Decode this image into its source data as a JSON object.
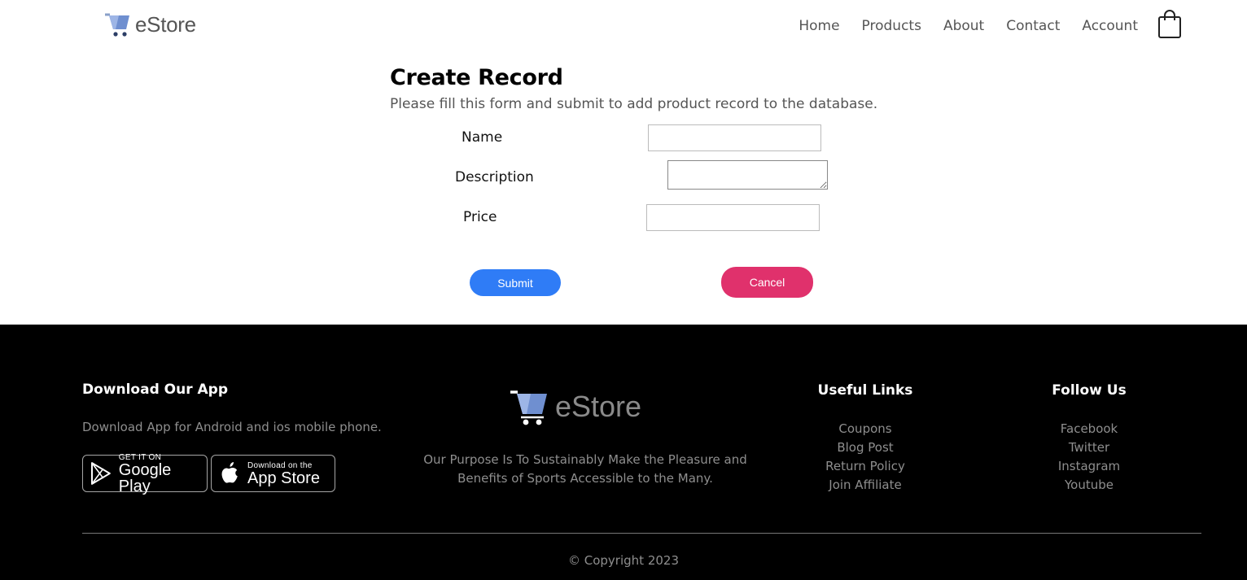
{
  "header": {
    "logo_text": "eStore",
    "nav": [
      {
        "label": "Home"
      },
      {
        "label": "Products"
      },
      {
        "label": "About"
      },
      {
        "label": "Contact"
      },
      {
        "label": "Account"
      }
    ],
    "cart_icon": "shopping-bag-icon"
  },
  "form": {
    "title": "Create Record",
    "subtitle": "Please fill this form and submit to add product record to the database.",
    "name_label": "Name",
    "name_value": "",
    "description_label": "Description",
    "description_value": "",
    "price_label": "Price",
    "price_value": "",
    "submit_label": "Submit",
    "cancel_label": "Cancel",
    "submit_color": "#2f7cf6",
    "cancel_color": "#e0316c"
  },
  "footer": {
    "app_heading": "Download Our App",
    "app_text": "Download App for Android and ios mobile phone.",
    "google_play": {
      "small": "GET IT ON",
      "big": "Google Play",
      "icon": "google-play-icon"
    },
    "app_store": {
      "small": "Download on the",
      "big": "App Store",
      "icon": "apple-icon"
    },
    "logo_text": "eStore",
    "purpose_line1": "Our Purpose Is To Sustainably Make the Pleasure and",
    "purpose_line2": "Benefits of Sports Accessible to the Many.",
    "useful_heading": "Useful Links",
    "useful_links": [
      "Coupons",
      "Blog Post",
      "Return Policy",
      "Join Affiliate"
    ],
    "follow_heading": "Follow Us",
    "follow_links": [
      "Facebook",
      "Twitter",
      "Instagram",
      "Youtube"
    ],
    "copyright": "© Copyright 2023"
  }
}
